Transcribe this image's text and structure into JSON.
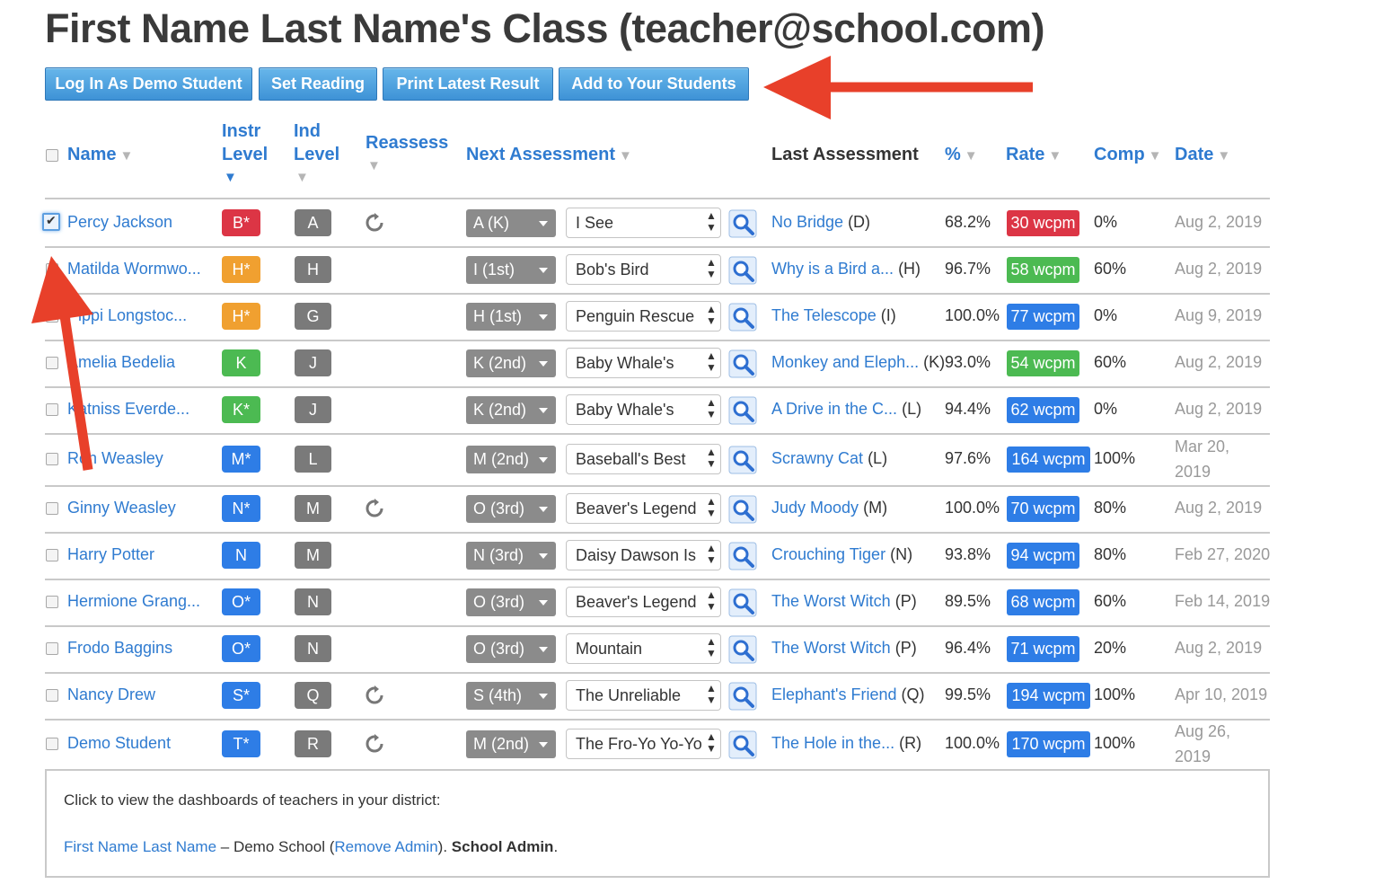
{
  "page": {
    "title": "First Name Last Name's Class (teacher@school.com)"
  },
  "toolbar": {
    "login_demo": "Log In As Demo Student",
    "set_reading": "Set Reading",
    "print_latest": "Print Latest Result",
    "add_students": "Add to Your Students"
  },
  "headers": {
    "name": "Name",
    "instr_level_1": "Instr",
    "instr_level_2": "Level",
    "ind_level_1": "Ind",
    "ind_level_2": "Level",
    "reassess": "Reassess",
    "next_assessment": "Next Assessment",
    "last_assessment": "Last Assessment",
    "percent": "%",
    "rate": "Rate",
    "comp": "Comp",
    "date": "Date"
  },
  "students": [
    {
      "name": "Percy Jackson",
      "checked": true,
      "instr": "B*",
      "instr_color": "#dc3545",
      "ind": "A",
      "reassess": true,
      "next": "A (K)",
      "book": "I See",
      "last_title": "No Bridge",
      "last_level": "(D)",
      "pct": "68.2%",
      "rate": "30 wcpm",
      "rate_color": "#dc3545",
      "comp": "0%",
      "date": "Aug 2, 2019"
    },
    {
      "name": "Matilda Wormwo...",
      "checked": false,
      "instr": "H*",
      "instr_color": "#f0a030",
      "ind": "H",
      "reassess": false,
      "next": "I (1st)",
      "book": "Bob's Bird",
      "last_title": "Why is a Bird a...",
      "last_level": "(H)",
      "pct": "96.7%",
      "rate": "58 wcpm",
      "rate_color": "#4cba52",
      "comp": "60%",
      "date": "Aug 2, 2019"
    },
    {
      "name": "Pippi Longstoc...",
      "checked": false,
      "instr": "H*",
      "instr_color": "#f0a030",
      "ind": "G",
      "reassess": false,
      "next": "H (1st)",
      "book": "Penguin Rescue",
      "last_title": "The Telescope",
      "last_level": "(I)",
      "pct": "100.0%",
      "rate": "77 wcpm",
      "rate_color": "#2e7de6",
      "comp": "0%",
      "date": "Aug 9, 2019"
    },
    {
      "name": "Amelia Bedelia",
      "checked": false,
      "instr": "K",
      "instr_color": "#4cba52",
      "ind": "J",
      "reassess": false,
      "next": "K (2nd)",
      "book": "Baby Whale's Mist",
      "last_title": "Monkey and Eleph...",
      "last_level": "(K)",
      "pct": "93.0%",
      "rate": "54 wcpm",
      "rate_color": "#4cba52",
      "comp": "60%",
      "date": "Aug 2, 2019"
    },
    {
      "name": "Katniss Everde...",
      "checked": false,
      "instr": "K*",
      "instr_color": "#4cba52",
      "ind": "J",
      "reassess": false,
      "next": "K (2nd)",
      "book": "Baby Whale's Mist",
      "last_title": "A Drive in the C...",
      "last_level": "(L)",
      "pct": "94.4%",
      "rate": "62 wcpm",
      "rate_color": "#2e7de6",
      "comp": "0%",
      "date": "Aug 2, 2019"
    },
    {
      "name": "Ron Weasley",
      "checked": false,
      "instr": "M*",
      "instr_color": "#2e7de6",
      "ind": "L",
      "reassess": false,
      "next": "M (2nd)",
      "book": "Baseball's Best",
      "last_title": "Scrawny Cat",
      "last_level": "(L)",
      "pct": "97.6%",
      "rate": "164 wcpm",
      "rate_color": "#2e7de6",
      "comp": "100%",
      "date_1": "Mar 20,",
      "date_2": "2019"
    },
    {
      "name": "Ginny Weasley",
      "checked": false,
      "instr": "N*",
      "instr_color": "#2e7de6",
      "ind": "M",
      "reassess": true,
      "next": "O (3rd)",
      "book": "Beaver's Legend",
      "last_title": "Judy Moody",
      "last_level": "(M)",
      "pct": "100.0%",
      "rate": "70 wcpm",
      "rate_color": "#2e7de6",
      "comp": "80%",
      "date": "Aug 2, 2019"
    },
    {
      "name": "Harry Potter",
      "checked": false,
      "instr": "N",
      "instr_color": "#2e7de6",
      "ind": "M",
      "reassess": false,
      "next": "N (3rd)",
      "book": "Daisy Dawson Is o",
      "last_title": "Crouching Tiger",
      "last_level": "(N)",
      "pct": "93.8%",
      "rate": "94 wcpm",
      "rate_color": "#2e7de6",
      "comp": "80%",
      "date": "Feb 27, 2020"
    },
    {
      "name": "Hermione Grang...",
      "checked": false,
      "instr": "O*",
      "instr_color": "#2e7de6",
      "ind": "N",
      "reassess": false,
      "next": "O (3rd)",
      "book": "Beaver's Legend",
      "last_title": "The Worst Witch",
      "last_level": "(P)",
      "pct": "89.5%",
      "rate": "68 wcpm",
      "rate_color": "#2e7de6",
      "comp": "60%",
      "date": "Feb 14, 2019"
    },
    {
      "name": "Frodo Baggins",
      "checked": false,
      "instr": "O*",
      "instr_color": "#2e7de6",
      "ind": "N",
      "reassess": false,
      "next": "O (3rd)",
      "book": "Mountain Adventu",
      "last_title": "The Worst Witch",
      "last_level": "(P)",
      "pct": "96.4%",
      "rate": "71 wcpm",
      "rate_color": "#2e7de6",
      "comp": "20%",
      "date": "Aug 2, 2019"
    },
    {
      "name": "Nancy Drew",
      "checked": false,
      "instr": "S*",
      "instr_color": "#2e7de6",
      "ind": "Q",
      "reassess": true,
      "next": "S (4th)",
      "book": "The Unreliable For",
      "last_title": "Elephant's Friend",
      "last_level": "(Q)",
      "pct": "99.5%",
      "rate": "194 wcpm",
      "rate_color": "#2e7de6",
      "comp": "100%",
      "date": "Apr 10, 2019"
    },
    {
      "name": "Demo Student",
      "checked": false,
      "instr": "T*",
      "instr_color": "#2e7de6",
      "ind": "R",
      "reassess": true,
      "next": "M (2nd)",
      "book": "The Fro-Yo Yo-Yo (",
      "last_title": "The Hole in the...",
      "last_level": "(R)",
      "pct": "100.0%",
      "rate": "170 wcpm",
      "rate_color": "#2e7de6",
      "comp": "100%",
      "date_1": "Aug 26,",
      "date_2": "2019"
    }
  ],
  "footer": {
    "intro": "Click to view the dashboards of teachers in your district:",
    "teacher_link": "First Name Last Name",
    "school_text": " – Demo School (",
    "remove_admin": "Remove Admin",
    "close_paren": ").",
    "role": " School Admin",
    "period": "."
  },
  "colors": {
    "link": "#2f7bd0",
    "arrow": "#e8402a",
    "button": "#4a9ee0"
  }
}
